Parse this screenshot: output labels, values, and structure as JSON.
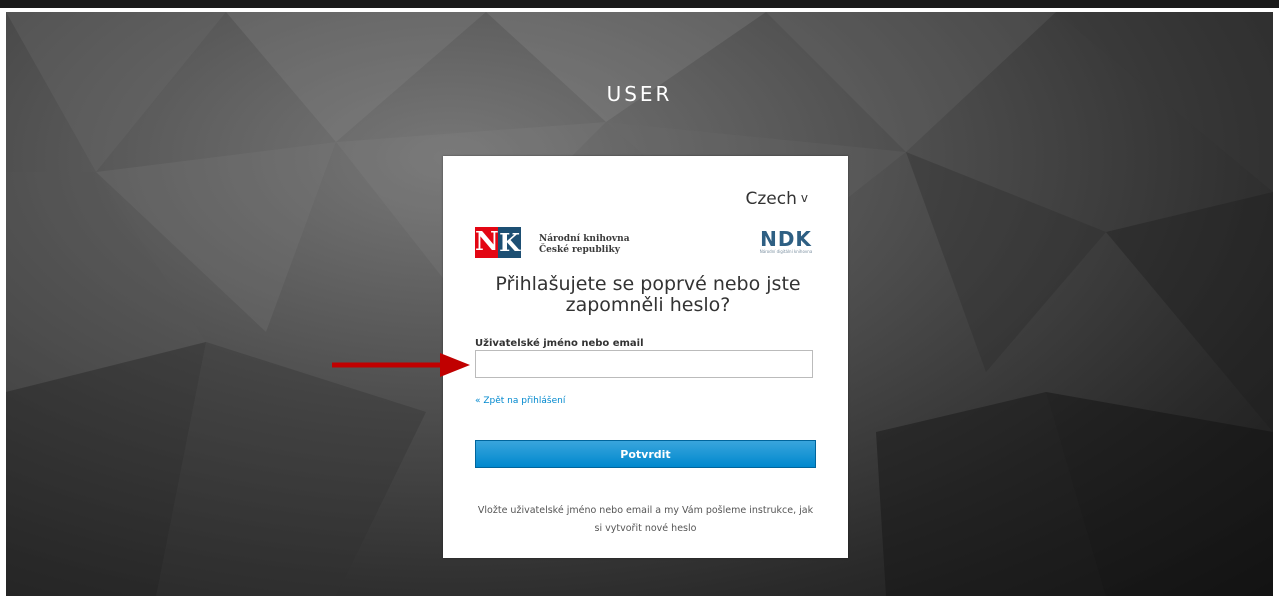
{
  "realm_title": "USER",
  "language": {
    "selected": "Czech",
    "chevron": "v"
  },
  "logos": {
    "nk_letters": {
      "n": "N",
      "k": "K"
    },
    "nk_name_line1": "Národní knihovna",
    "nk_name_line2": "České republiky",
    "ndk_big": "NDK",
    "ndk_small": "Národní digitální knihovna"
  },
  "form": {
    "heading": "Přihlašujete se poprvé nebo jste zapomněli heslo?",
    "username_label": "Uživatelské jméno nebo email",
    "username_value": "",
    "back_link": "« Zpět na přihlášení",
    "submit_label": "Potvrdit",
    "info_text": "Vložte uživatelské jméno nebo email a my Vám pošleme instrukce, jak si vytvořit nové heslo"
  },
  "colors": {
    "primary": "#0088ce",
    "annotation_arrow": "#c00000",
    "nk_red": "#e30613",
    "nk_blue": "#1d4f73"
  },
  "icons": {
    "chevron": "chevron-down-icon",
    "annotation": "red-arrow-icon"
  }
}
